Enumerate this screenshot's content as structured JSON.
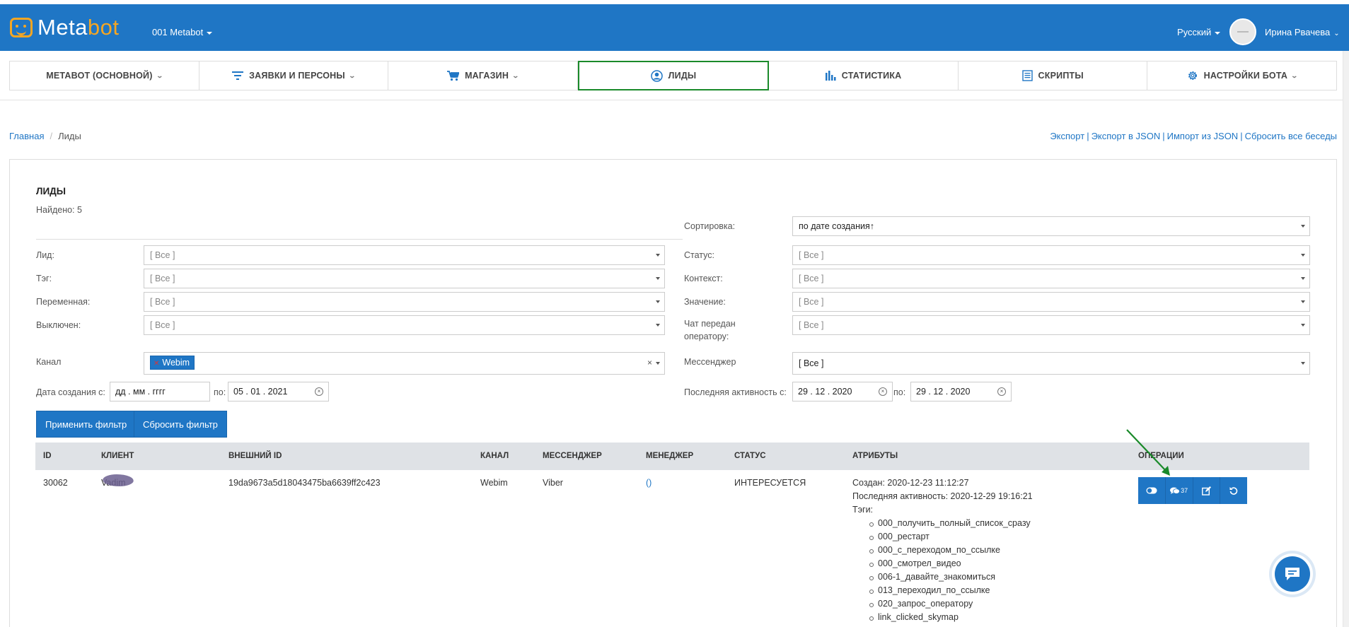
{
  "header": {
    "logo_main": "Meta",
    "logo_accent": "bot",
    "bot_selector": "001 Metabot",
    "language": "Русский",
    "user_name": "Ирина Рвачева"
  },
  "nav": {
    "tabs": [
      {
        "label": "МЕТАВОТ (ОСНОВНОЙ)",
        "icon": "none",
        "dropdown": true
      },
      {
        "label": "ЗАЯВКИ И ПЕРСОНЫ",
        "icon": "filter-icon",
        "dropdown": true
      },
      {
        "label": "МАГАЗИН",
        "icon": "cart-icon",
        "dropdown": true
      },
      {
        "label": "ЛИДЫ",
        "icon": "person-circle-icon",
        "dropdown": false,
        "active": true
      },
      {
        "label": "СТАТИСТИКА",
        "icon": "bar-chart-icon",
        "dropdown": false
      },
      {
        "label": "СКРИПТЫ",
        "icon": "document-icon",
        "dropdown": false
      },
      {
        "label": "НАСТРОЙКИ БОТА",
        "icon": "gear-icon",
        "dropdown": true
      }
    ]
  },
  "breadcrumb": {
    "home": "Главная",
    "current": "Лиды"
  },
  "top_links": {
    "export": "Экспорт",
    "export_json": "Экспорт в JSON",
    "import_json": "Импорт из JSON",
    "reset_chats": "Сбросить все беседы"
  },
  "panel": {
    "title": "ЛИДЫ",
    "found": "Найдено: 5"
  },
  "filters": {
    "sort_label": "Сортировка:",
    "sort_value": "по дате создания↑",
    "lead_label": "Лид:",
    "lead_value": "[ Все ]",
    "tag_label": "Тэг:",
    "tag_value": "[ Все ]",
    "variable_label": "Переменная:",
    "variable_value": "[ Все ]",
    "disabled_label": "Выключен:",
    "disabled_value": "[ Все ]",
    "status_label": "Статус:",
    "status_value": "[ Все ]",
    "context_label": "Контекст:",
    "context_value": "[ Все ]",
    "value_label": "Значение:",
    "value_value": "[ Все ]",
    "operator_label": "Чат передан оператору:",
    "operator_value": "[ Все ]",
    "channel_label": "Канал",
    "channel_chip": "Webim",
    "messenger_label": "Мессенджер",
    "messenger_value": "[ Все ]",
    "created_from_label": "Дата создания с:",
    "created_from_placeholder": "дд . мм . гггг",
    "created_to_label": "по:",
    "created_to_value": "05 . 01 . 2021",
    "activity_from_label": "Последняя активность с:",
    "activity_from_value": "29 . 12 . 2020",
    "activity_to_label": "по:",
    "activity_to_value": "29 . 12 . 2020",
    "apply_button": "Применить фильтр",
    "reset_button": "Сбросить фильтр"
  },
  "table": {
    "columns": [
      "ID",
      "КЛИЕНТ",
      "ВНЕШНИЙ ID",
      "КАНАЛ",
      "МЕССЕНДЖЕР",
      "МЕНЕДЖЕР",
      "СТАТУС",
      "АТРИБУТЫ",
      "ОПЕРАЦИИ"
    ],
    "rows": [
      {
        "id": "30062",
        "client": "Vadim",
        "external_id": "19da9673a5d18043475ba6639ff2c423",
        "channel": "Webim",
        "messenger": "Viber",
        "manager": "()",
        "status": "ИНТЕРЕСУЕТСЯ",
        "created": "Создан: 2020-12-23 11:12:27",
        "last_activity": "Последняя активность: 2020-12-29 19:16:21",
        "tags_label": "Тэги:",
        "tags": [
          "000_получить_полный_список_сразу",
          "000_рестарт",
          "000_с_переходом_по_ссылке",
          "000_смотрел_видео",
          "006-1_давайте_знакомиться",
          "013_переходил_по_ссылке",
          "020_запрос_оператору",
          "link_clicked_skymap"
        ],
        "chat_count": "37"
      }
    ]
  },
  "colors": {
    "primary": "#1f76c5",
    "accent": "#f5a623",
    "active_tab_border": "#1a8a2a",
    "arrow": "#1a8a2a"
  }
}
